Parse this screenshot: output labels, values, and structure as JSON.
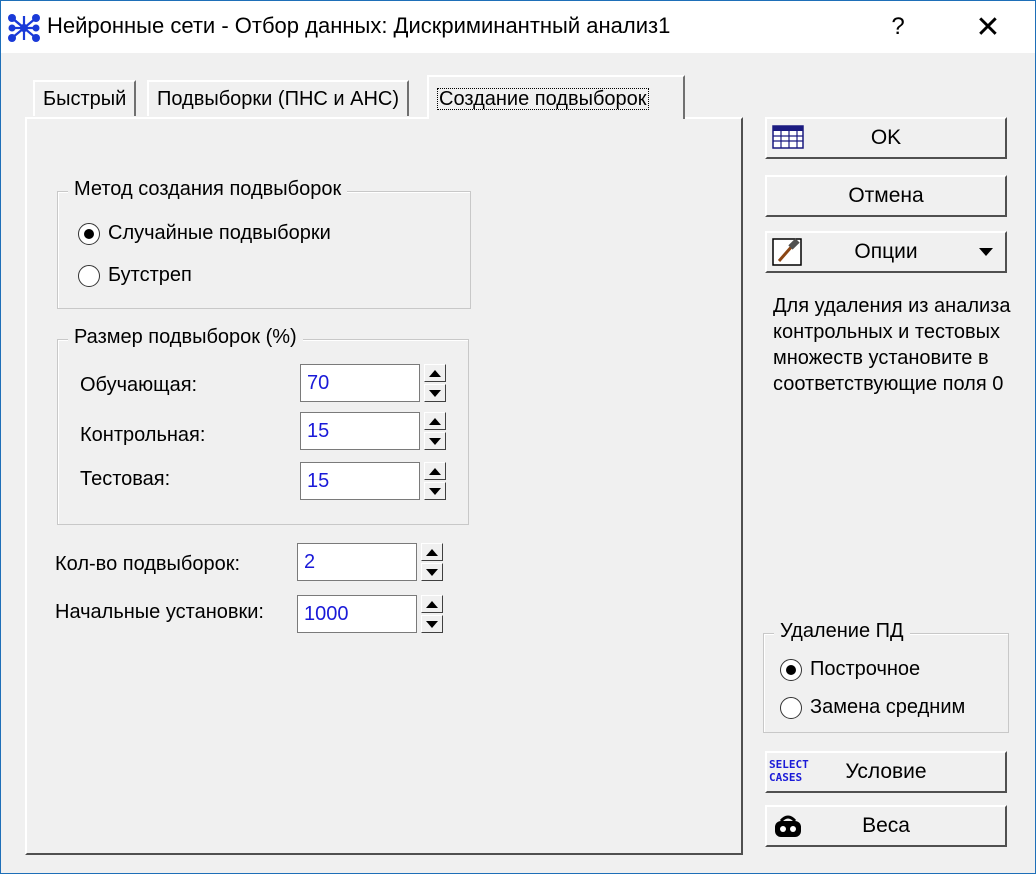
{
  "window": {
    "title": "Нейронные сети - Отбор данных: Дискриминантный анализ1",
    "help_label": "?",
    "close_label": "✕"
  },
  "tabs": [
    {
      "label": "Быстрый",
      "active": false
    },
    {
      "label": "Подвыборки (ПНС и АНС)",
      "active": false
    },
    {
      "label": "Создание подвыборок",
      "active": true
    }
  ],
  "method_group": {
    "title": "Метод создания подвыборок",
    "options": [
      {
        "label": "Случайные подвыборки",
        "checked": true
      },
      {
        "label": "Бутстреп",
        "checked": false
      }
    ]
  },
  "size_group": {
    "title": "Размер подвыборок (%)",
    "fields": [
      {
        "label": "Обучающая:",
        "value": "70"
      },
      {
        "label": "Контрольная:",
        "value": "15"
      },
      {
        "label": "Тестовая:",
        "value": "15"
      }
    ]
  },
  "extra_fields": [
    {
      "label": "Кол-во подвыборок:",
      "value": "2"
    },
    {
      "label": "Начальные установки:",
      "value": "1000"
    }
  ],
  "buttons": {
    "ok": "OK",
    "cancel": "Отмена",
    "options": "Опции",
    "condition": "Условие",
    "weights": "Веса"
  },
  "note": "Для удаления из анализа контрольных и тестовых множеств установите в соответствующие поля 0",
  "missing_group": {
    "title": "Удаление ПД",
    "options": [
      {
        "label": "Построчное",
        "checked": true
      },
      {
        "label": "Замена средним",
        "checked": false
      }
    ]
  },
  "select_cases_icon": {
    "line1": "SELECT",
    "line2": "CASES"
  },
  "icons": [
    "app-icon",
    "ok-grid-icon",
    "options-icon",
    "select-cases-icon",
    "weights-icon"
  ]
}
